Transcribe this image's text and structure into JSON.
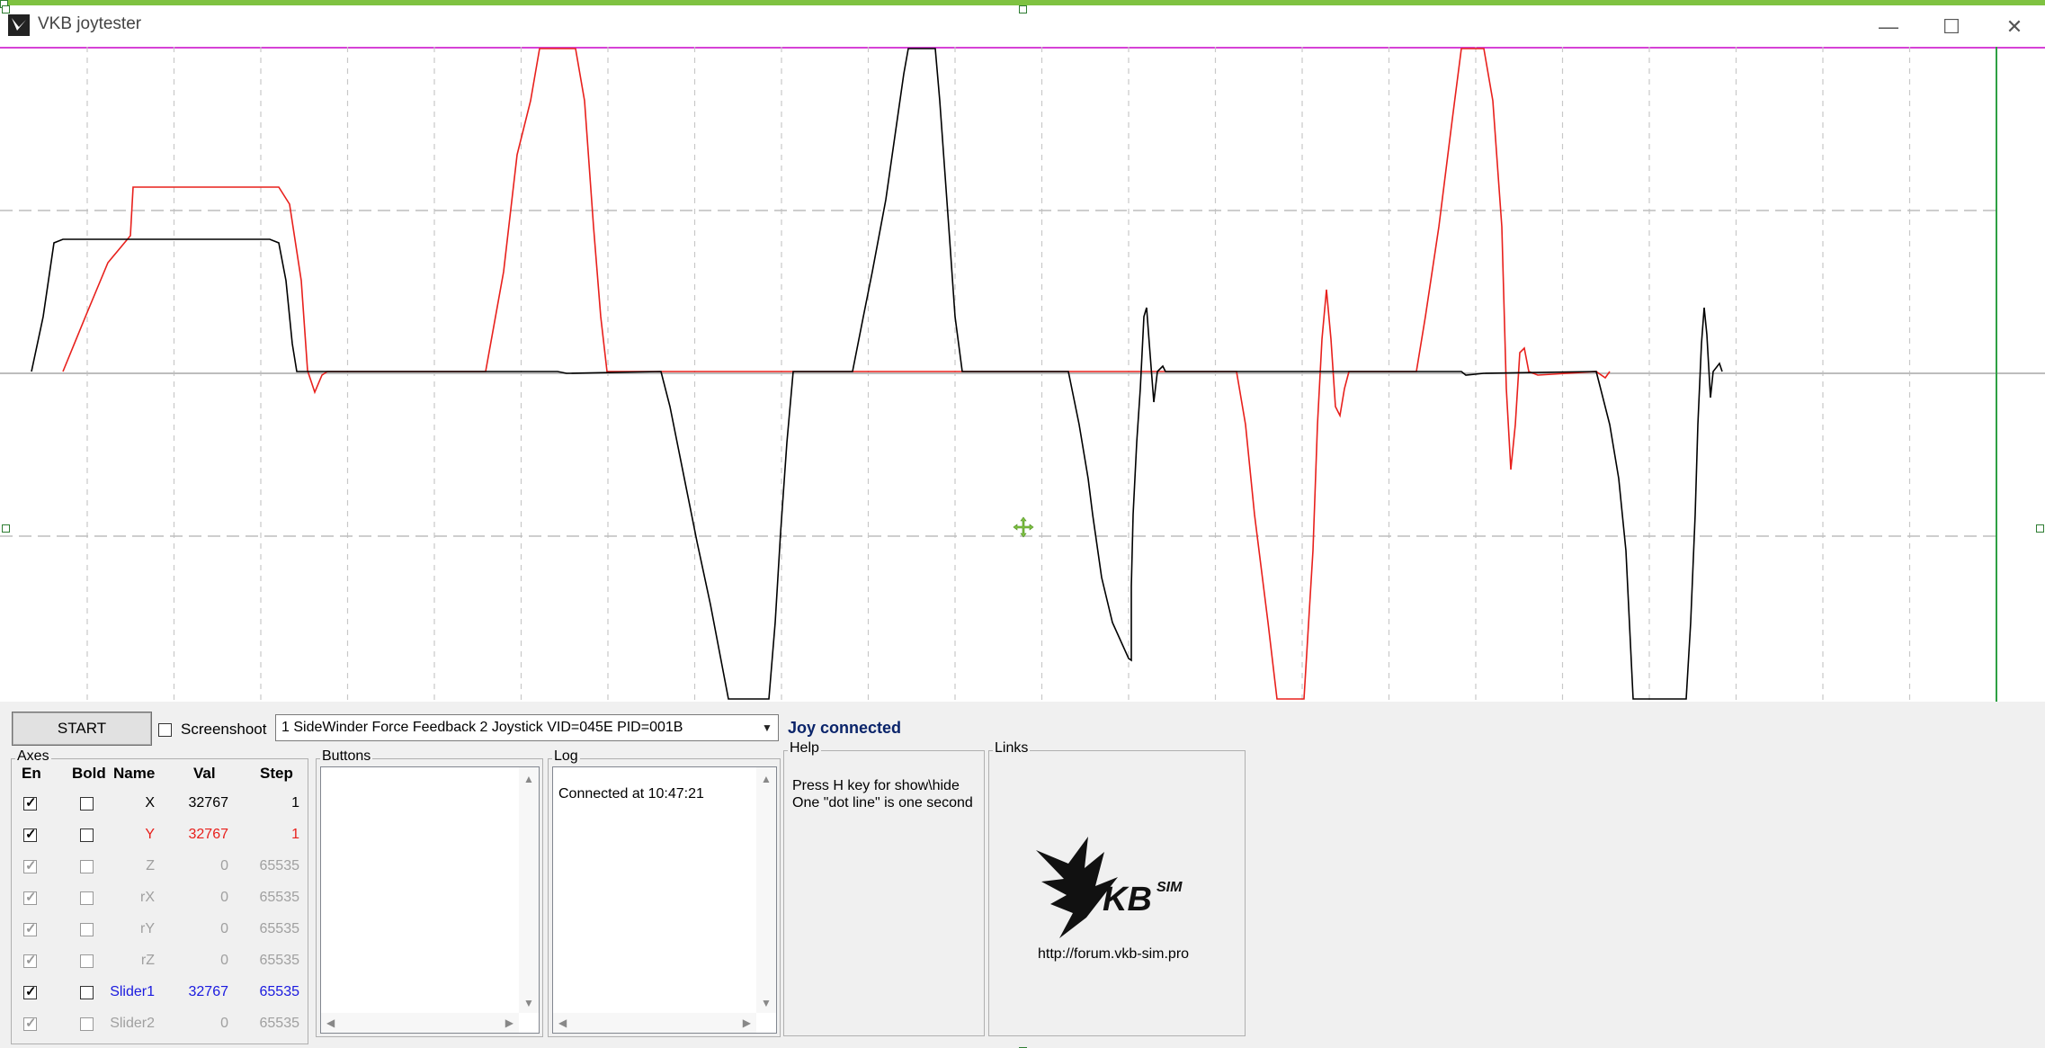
{
  "window": {
    "title": "VKB joytester"
  },
  "colors": {
    "x_trace": "#000000",
    "y_trace": "#e8201c",
    "slider_color": "#1a1adf",
    "status_color": "#0a246a",
    "cursor_line": "#2ea043",
    "top_border": "#d642d6"
  },
  "toolbar": {
    "start_label": "START",
    "screenshot_label": "Screenshoot",
    "device_selected": "1 SideWinder Force Feedback 2 Joystick VID=045E PID=001B",
    "status": "Joy connected"
  },
  "axes": {
    "title": "Axes",
    "headers": [
      "En",
      "Bold",
      "Name",
      "Val",
      "Step"
    ],
    "rows": [
      {
        "name": "X",
        "val": "32767",
        "step": "1",
        "en": true,
        "enabled": true,
        "color": "#000000"
      },
      {
        "name": "Y",
        "val": "32767",
        "step": "1",
        "en": true,
        "enabled": true,
        "color": "#e8201c"
      },
      {
        "name": "Z",
        "val": "0",
        "step": "65535",
        "en": true,
        "enabled": false,
        "color": "#a0a0a0"
      },
      {
        "name": "rX",
        "val": "0",
        "step": "65535",
        "en": true,
        "enabled": false,
        "color": "#a0a0a0"
      },
      {
        "name": "rY",
        "val": "0",
        "step": "65535",
        "en": true,
        "enabled": false,
        "color": "#a0a0a0"
      },
      {
        "name": "rZ",
        "val": "0",
        "step": "65535",
        "en": true,
        "enabled": false,
        "color": "#a0a0a0"
      },
      {
        "name": "Slider1",
        "val": "32767",
        "step": "65535",
        "en": true,
        "enabled": true,
        "color": "#1a1adf"
      },
      {
        "name": "Slider2",
        "val": "0",
        "step": "65535",
        "en": true,
        "enabled": false,
        "color": "#a0a0a0"
      }
    ]
  },
  "buttons_group": {
    "title": "Buttons"
  },
  "log": {
    "title": "Log",
    "lines": [
      "Connected at 10:47:21"
    ]
  },
  "help": {
    "title": "Help",
    "lines": [
      "Press H key for show\\hide",
      "One \"dot line\" is one second"
    ]
  },
  "links": {
    "title": "Links",
    "url": "http://forum.vkb-sim.pro",
    "logo_text": "KB",
    "logo_sup": "SIM"
  }
}
